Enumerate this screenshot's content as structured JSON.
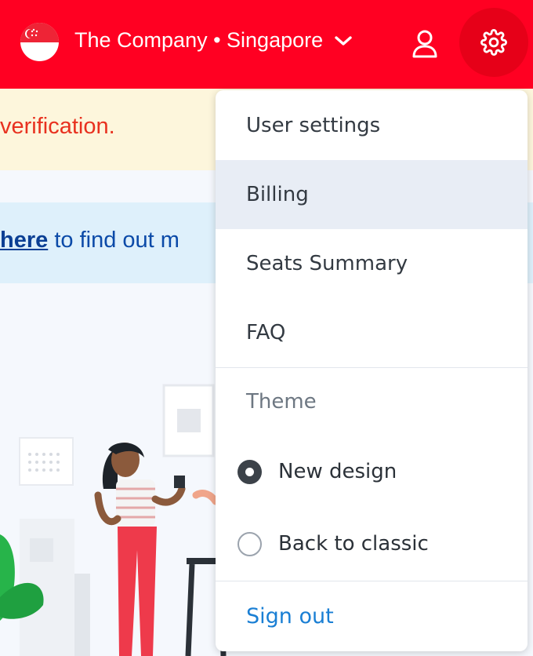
{
  "header": {
    "company_label": "The Company • Singapore",
    "bg_color": "#ff0022",
    "flag_icon": "singapore-flag",
    "user_icon": "user-icon",
    "settings_icon": "gear-icon"
  },
  "warning_banner": {
    "text": "verification."
  },
  "info_banner": {
    "link_text": "here",
    "text": " to find out m"
  },
  "menu": {
    "items": [
      {
        "label": "User settings"
      },
      {
        "label": "Billing"
      },
      {
        "label": "Seats Summary"
      },
      {
        "label": "FAQ"
      }
    ],
    "theme_heading": "Theme",
    "theme_options": [
      {
        "label": "New design",
        "selected": true
      },
      {
        "label": "Back to classic",
        "selected": false
      }
    ],
    "sign_out": "Sign out",
    "hover_color": "#e8edf5",
    "link_color": "#1a7fd4"
  }
}
